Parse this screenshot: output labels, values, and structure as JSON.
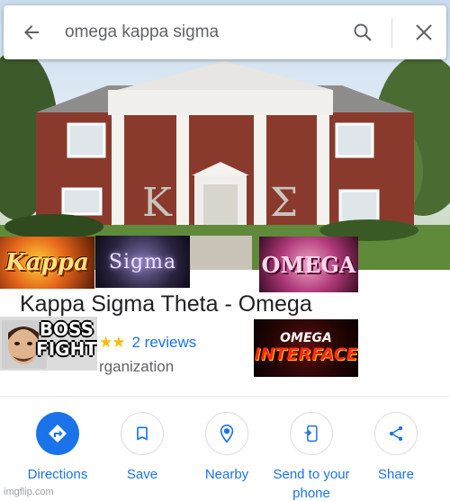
{
  "search": {
    "query": "omega kappa sigma",
    "icons": {
      "back": "arrow-left-icon",
      "search": "magnifier-icon",
      "close": "x-icon"
    }
  },
  "place": {
    "name": "Kappa Sigma Theta - Omega",
    "stars_visible": "★★",
    "reviews": "2 reviews",
    "category_fragment": "rganization"
  },
  "actions": [
    {
      "label": "Directions",
      "icon": "directions-icon"
    },
    {
      "label": "Save",
      "icon": "bookmark-icon"
    },
    {
      "label": "Nearby",
      "icon": "nearby-icon"
    },
    {
      "label": "Send to your phone",
      "icon": "send-to-phone-icon"
    },
    {
      "label": "Share",
      "icon": "share-icon"
    }
  ],
  "stickers": {
    "kappa": "Kappa",
    "sigma": "Sigma",
    "omega": "OMEGA",
    "boss": "BOSS FIGHT",
    "interface_top": "OMEGA",
    "interface_bottom": "INTERFACE"
  },
  "colors": {
    "accent": "#1a73e8",
    "star": "#fbbc04",
    "text": "#202124",
    "muted": "#5f6368"
  },
  "watermark": "imgflip.com"
}
